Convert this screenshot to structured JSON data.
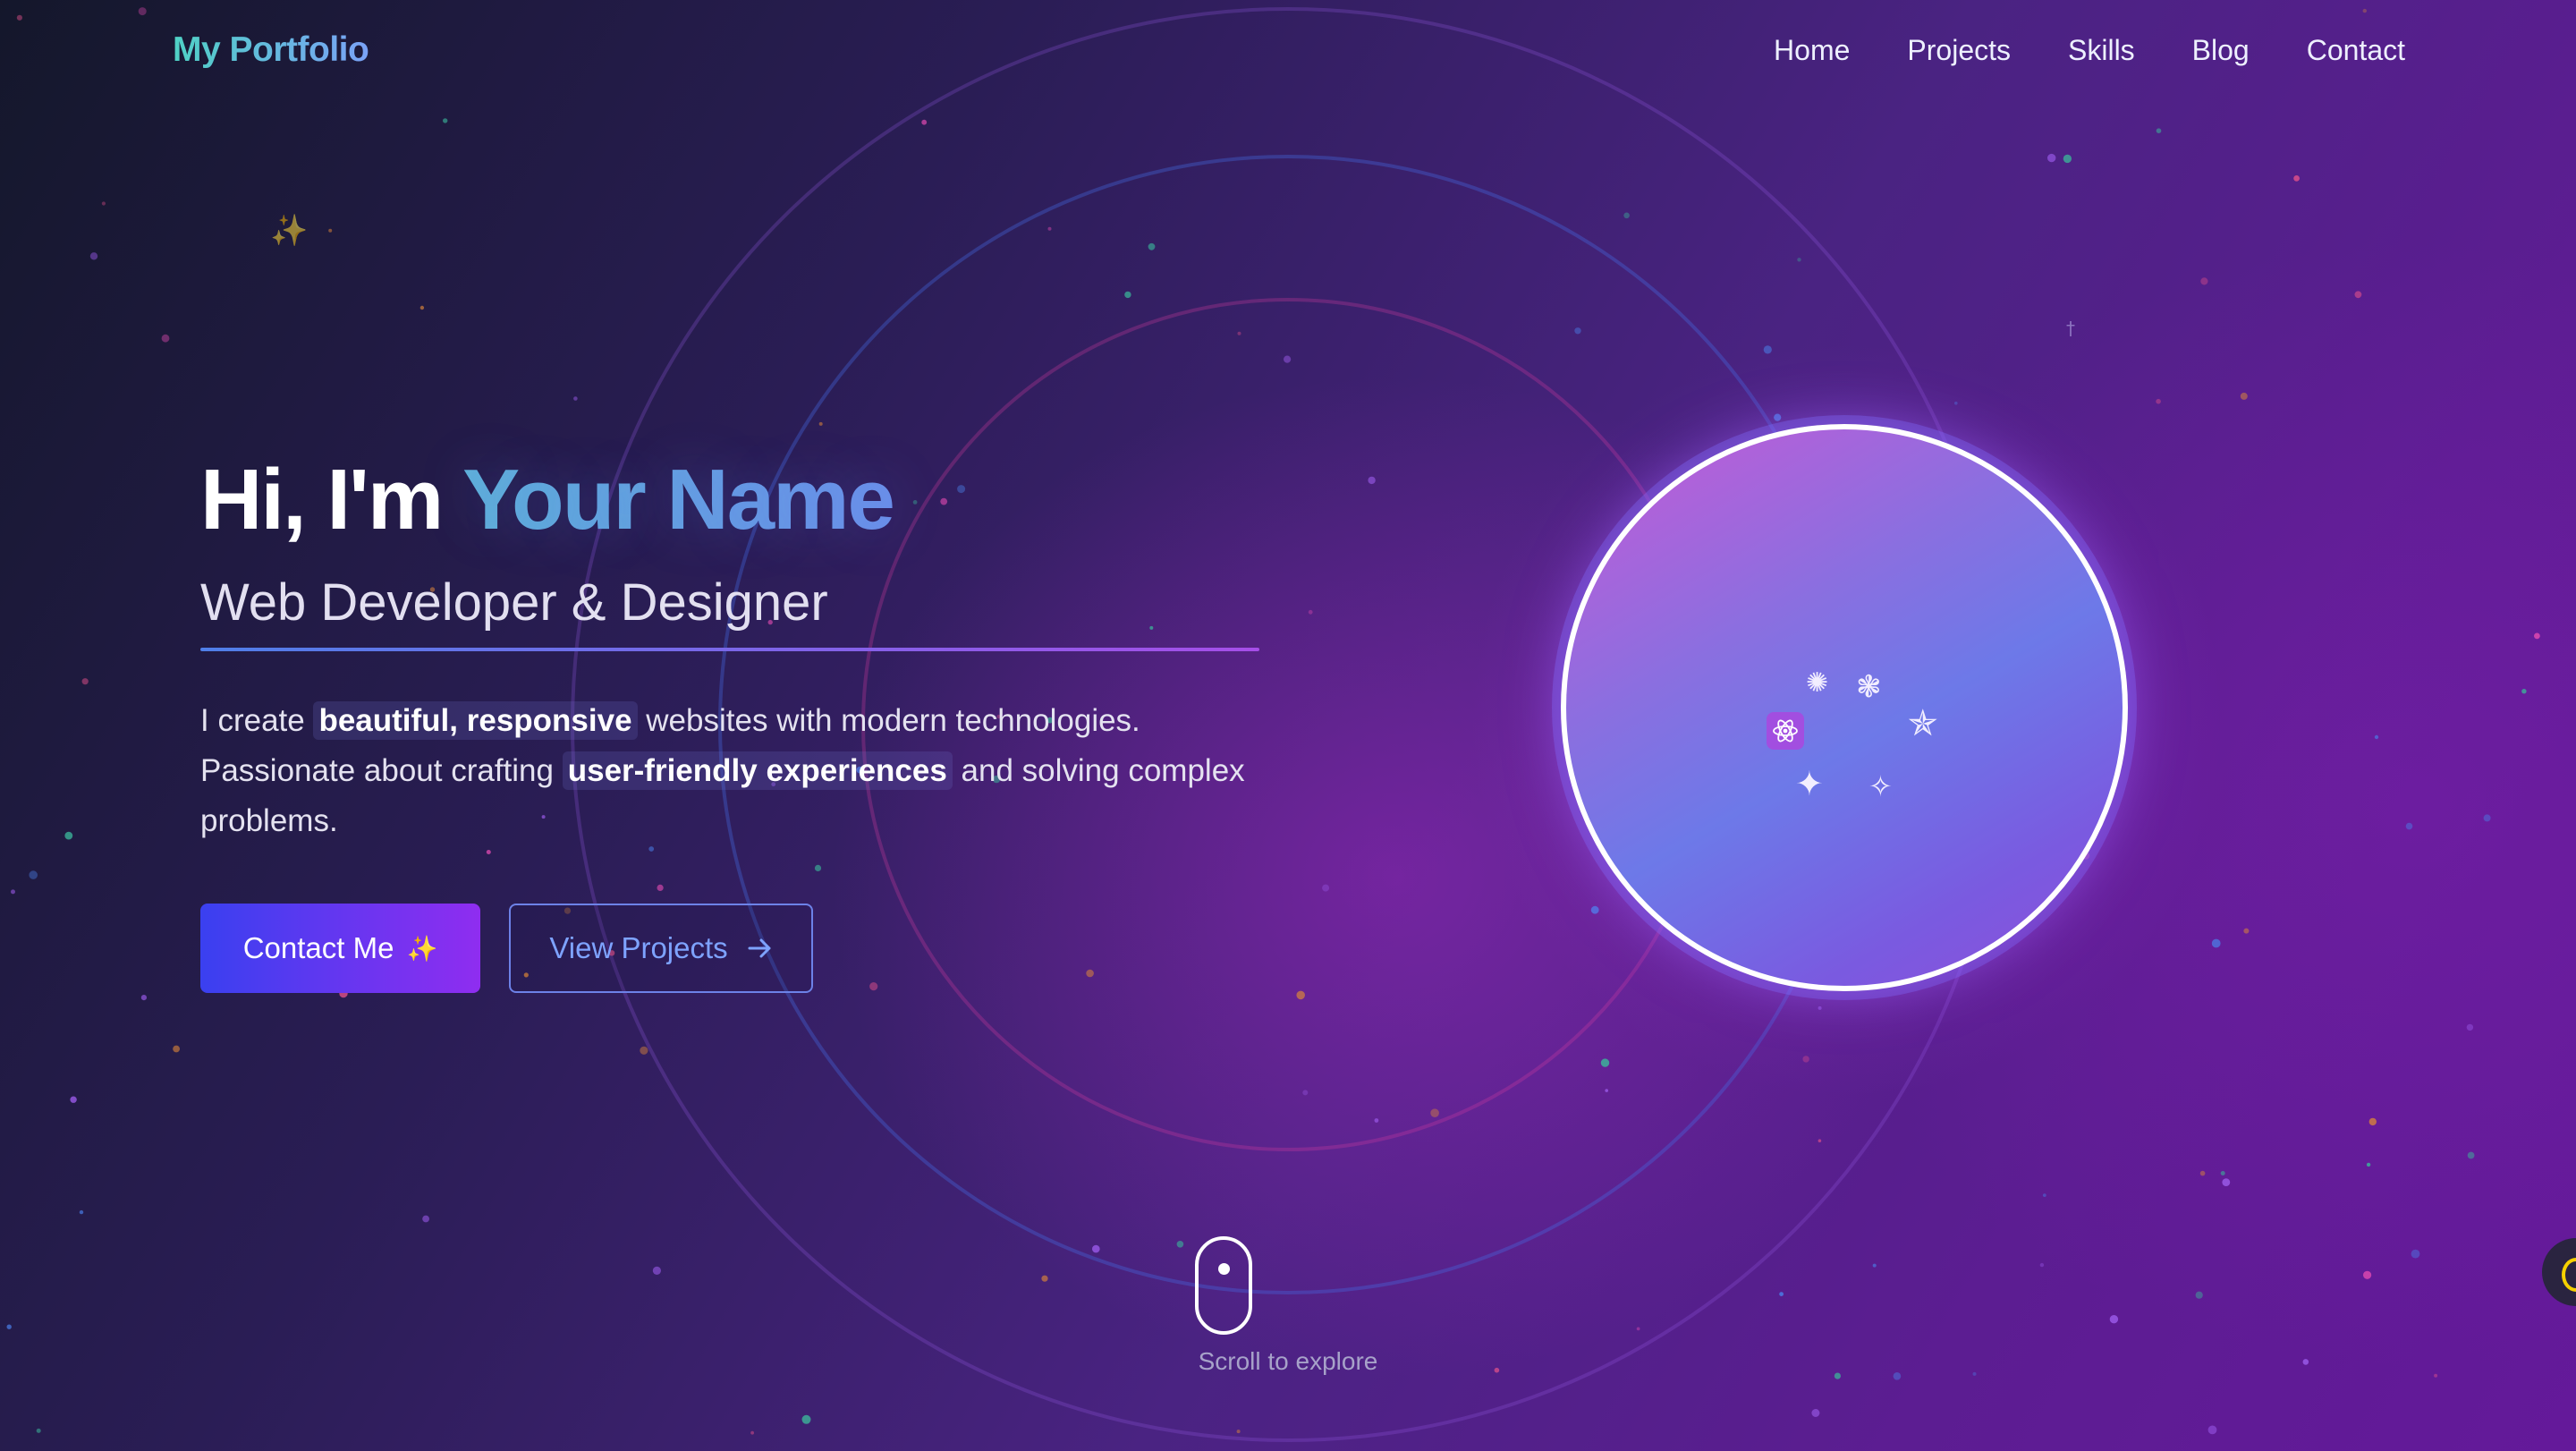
{
  "brand": "My Portfolio",
  "nav": {
    "items": [
      "Home",
      "Projects",
      "Skills",
      "Blog",
      "Contact"
    ]
  },
  "hero": {
    "greeting": "Hi, I'm ",
    "name": "Your Name",
    "subtitle": "Web Developer & Designer",
    "desc_1": "I create ",
    "desc_hl_1": "beautiful, responsive",
    "desc_2": " websites with modern technologies. Passionate about crafting ",
    "desc_hl_2": "user-friendly experiences",
    "desc_3": " and solving complex problems."
  },
  "buttons": {
    "contact": "Contact Me",
    "contact_icon": "sparkles-icon",
    "projects": "View Projects",
    "projects_icon": "arrow-right-icon"
  },
  "avatar": {
    "icons": [
      "sun-icon",
      "snowflake-icon",
      "atom-icon",
      "star-icon",
      "sparkle-icon",
      "sparkle-outline-icon"
    ]
  },
  "scroll": {
    "label": "Scroll to explore"
  },
  "theme_toggle": {
    "icon": "moon-icon"
  },
  "colors": {
    "accent_primary_start": "#3a40f0",
    "accent_primary_end": "#8f2df0",
    "name_gradient_start": "#5fb0d8",
    "name_gradient_end": "#6b8fe8",
    "brand_gradient_start": "#4fd1c5",
    "brand_gradient_end": "#7aa2f7"
  }
}
